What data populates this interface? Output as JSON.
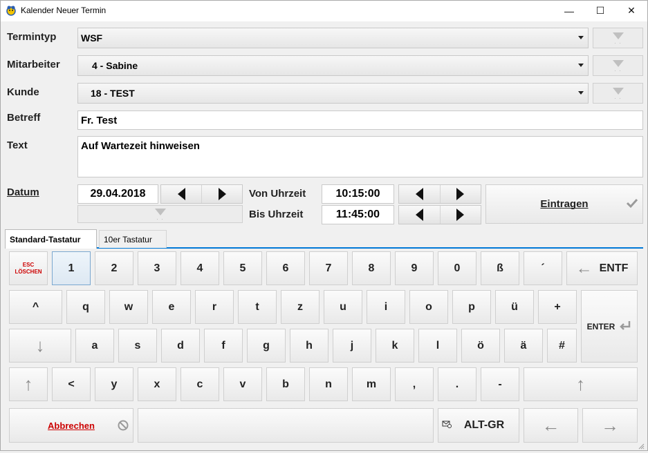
{
  "window": {
    "title": "Kalender Neuer Termin",
    "minimize": "—",
    "maximize": "☐",
    "close": "✕"
  },
  "form": {
    "termintyp_label": "Termintyp",
    "termintyp_value": "WSF",
    "mitarbeiter_label": "Mitarbeiter",
    "mitarbeiter_value": "4 - Sabine",
    "kunde_label": "Kunde",
    "kunde_value": "18 - TEST",
    "betreff_label": "Betreff",
    "betreff_value": "Fr. Test",
    "text_label": "Text",
    "text_value": "Auf Wartezeit hinweisen",
    "datum_label": "Datum",
    "datum_value": "29.04.2018",
    "von_label": "Von Uhrzeit",
    "von_value": "10:15:00",
    "bis_label": "Bis Uhrzeit",
    "bis_value": "11:45:00",
    "eintragen_label": "Eintragen"
  },
  "tabs": [
    {
      "label": "Standard-Tastatur",
      "active": true
    },
    {
      "label": "10er Tastatur",
      "active": false
    }
  ],
  "keyboard": {
    "esc_top": "ESC",
    "esc_bottom": "LÖSCHEN",
    "row1": [
      "1",
      "2",
      "3",
      "4",
      "5",
      "6",
      "7",
      "8",
      "9",
      "0",
      "ß",
      "´"
    ],
    "entf": "ENTF",
    "caret": "^",
    "row2": [
      "q",
      "w",
      "e",
      "r",
      "t",
      "z",
      "u",
      "i",
      "o",
      "p",
      "ü",
      "+"
    ],
    "enter": "ENTER",
    "row3": [
      "a",
      "s",
      "d",
      "f",
      "g",
      "h",
      "j",
      "k",
      "l",
      "ö",
      "ä",
      "#"
    ],
    "row4": [
      "<",
      "y",
      "x",
      "c",
      "v",
      "b",
      "n",
      "m",
      ",",
      ".",
      "-"
    ],
    "abbrechen": "Abbrechen",
    "altgr": "ALT-GR"
  },
  "colors": {
    "accent": "#0078d7",
    "danger": "#cc0000"
  },
  "icons": [
    "app-icon",
    "dropdown-arrow-icon",
    "filter-icon",
    "left-arrow-icon",
    "right-arrow-icon",
    "checkmark-icon",
    "backspace-arrow-icon",
    "enter-icon",
    "shift-up-icon",
    "down-arrow-icon",
    "cancel-icon",
    "mail-icon"
  ]
}
